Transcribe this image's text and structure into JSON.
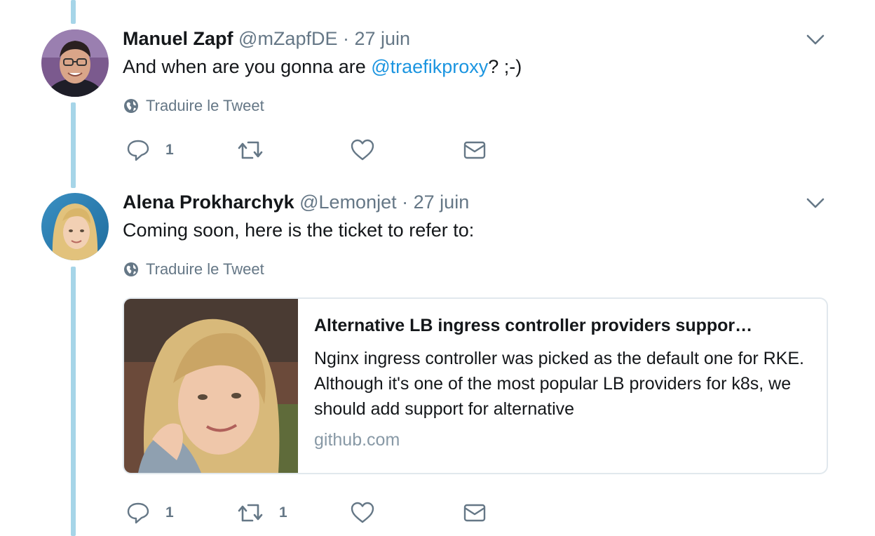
{
  "tweets": [
    {
      "name": "Manuel Zapf",
      "handle": "@mZapfDE",
      "separator": "·",
      "date": "27 juin",
      "text_before": "And when are you gonna are ",
      "mention": "@traefikproxy",
      "text_after": "? ;-)",
      "translate": "Traduire le Tweet",
      "reply_count": "1",
      "retweet_count": "",
      "avatar_icon": "avatar-man-glasses"
    },
    {
      "name": "Alena Prokharchyk",
      "handle": "@Lemonjet",
      "separator": "·",
      "date": "27 juin",
      "text": "Coming soon, here is the ticket to refer to:",
      "translate": "Traduire le Tweet",
      "reply_count": "1",
      "retweet_count": "1",
      "avatar_icon": "avatar-woman-blonde",
      "card": {
        "title": "Alternative LB ingress controller providers suppor…",
        "description": "Nginx ingress controller was picked as the default one for RKE. Although it's one of the most popular LB providers for k8s, we should add support for alternative",
        "domain": "github.com"
      }
    }
  ],
  "icons": {
    "caret": "chevron-down-icon",
    "globe": "globe-icon",
    "reply": "reply-icon",
    "retweet": "retweet-icon",
    "like": "heart-icon",
    "dm": "envelope-icon"
  },
  "colors": {
    "thread_line": "#a6d5e8",
    "link": "#1b95e0",
    "secondary_text": "#657786",
    "domain_text": "#8899a6"
  }
}
